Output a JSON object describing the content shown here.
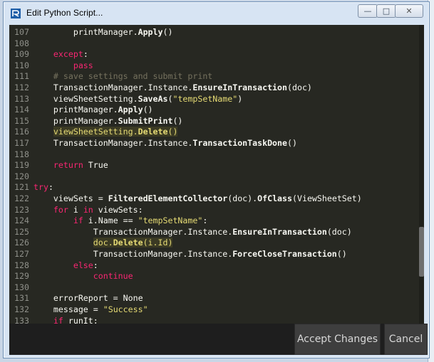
{
  "window": {
    "title": "Edit Python Script..."
  },
  "controls": {
    "minimize": "—",
    "maximize": "□",
    "close": "✕"
  },
  "code_lines": [
    {
      "n": "107",
      "segments": [
        {
          "t": "        "
        },
        {
          "t": "printManager.",
          "c": ""
        },
        {
          "t": "Apply",
          "c": "fn"
        },
        {
          "t": "()"
        }
      ]
    },
    {
      "n": "108",
      "segments": []
    },
    {
      "n": "109",
      "segments": [
        {
          "t": "    "
        },
        {
          "t": "except",
          "c": "kw"
        },
        {
          "t": ":"
        }
      ]
    },
    {
      "n": "110",
      "segments": [
        {
          "t": "        "
        },
        {
          "t": "pass",
          "c": "kw"
        }
      ]
    },
    {
      "n": "111",
      "segments": [
        {
          "t": "    "
        },
        {
          "t": "# save settings and submit print",
          "c": "cm"
        }
      ]
    },
    {
      "n": "112",
      "segments": [
        {
          "t": "    TransactionManager.Instance."
        },
        {
          "t": "EnsureInTransaction",
          "c": "fn"
        },
        {
          "t": "(doc)"
        }
      ]
    },
    {
      "n": "113",
      "segments": [
        {
          "t": "    viewSheetSetting."
        },
        {
          "t": "SaveAs",
          "c": "fn"
        },
        {
          "t": "("
        },
        {
          "t": "\"tempSetName\"",
          "c": "str"
        },
        {
          "t": ")"
        }
      ]
    },
    {
      "n": "114",
      "segments": [
        {
          "t": "    printManager."
        },
        {
          "t": "Apply",
          "c": "fn"
        },
        {
          "t": "()"
        }
      ]
    },
    {
      "n": "115",
      "segments": [
        {
          "t": "    printManager."
        },
        {
          "t": "SubmitPrint",
          "c": "fn"
        },
        {
          "t": "()"
        }
      ]
    },
    {
      "n": "116",
      "segments": [
        {
          "t": "    "
        },
        {
          "t": "viewSheetSetting.",
          "c": "hlw hl"
        },
        {
          "t": "Delete",
          "c": "fn hlw hl"
        },
        {
          "t": "()",
          "c": "hlw hl"
        }
      ]
    },
    {
      "n": "117",
      "segments": [
        {
          "t": "    TransactionManager.Instance."
        },
        {
          "t": "TransactionTaskDone",
          "c": "fn"
        },
        {
          "t": "()"
        }
      ]
    },
    {
      "n": "118",
      "segments": []
    },
    {
      "n": "119",
      "segments": [
        {
          "t": "    "
        },
        {
          "t": "return",
          "c": "kw"
        },
        {
          "t": " True"
        }
      ]
    },
    {
      "n": "120",
      "segments": []
    },
    {
      "n": "121",
      "segments": [
        {
          "t": "try",
          "c": "kw"
        },
        {
          "t": ":"
        }
      ]
    },
    {
      "n": "122",
      "segments": [
        {
          "t": "    viewSets = "
        },
        {
          "t": "FilteredElementCollector",
          "c": "fn"
        },
        {
          "t": "(doc)."
        },
        {
          "t": "OfClass",
          "c": "fn"
        },
        {
          "t": "(ViewSheetSet)"
        }
      ]
    },
    {
      "n": "123",
      "segments": [
        {
          "t": "    "
        },
        {
          "t": "for",
          "c": "kw"
        },
        {
          "t": " i "
        },
        {
          "t": "in",
          "c": "kw"
        },
        {
          "t": " viewSets:"
        }
      ]
    },
    {
      "n": "124",
      "segments": [
        {
          "t": "        "
        },
        {
          "t": "if",
          "c": "kw"
        },
        {
          "t": " i.Name == "
        },
        {
          "t": "\"tempSetName\"",
          "c": "str"
        },
        {
          "t": ":"
        }
      ]
    },
    {
      "n": "125",
      "segments": [
        {
          "t": "            TransactionManager.Instance."
        },
        {
          "t": "EnsureInTransaction",
          "c": "fn"
        },
        {
          "t": "(doc)"
        }
      ]
    },
    {
      "n": "126",
      "segments": [
        {
          "t": "            "
        },
        {
          "t": "doc.",
          "c": "hlw hl"
        },
        {
          "t": "Delete",
          "c": "fn hlw hl"
        },
        {
          "t": "(i.Id)",
          "c": "hlw hl"
        }
      ]
    },
    {
      "n": "127",
      "segments": [
        {
          "t": "            TransactionManager.Instance."
        },
        {
          "t": "ForceCloseTransaction",
          "c": "fn"
        },
        {
          "t": "()"
        }
      ]
    },
    {
      "n": "128",
      "segments": [
        {
          "t": "        "
        },
        {
          "t": "else",
          "c": "kw"
        },
        {
          "t": ":"
        }
      ]
    },
    {
      "n": "129",
      "segments": [
        {
          "t": "            "
        },
        {
          "t": "continue",
          "c": "kw"
        }
      ]
    },
    {
      "n": "130",
      "segments": []
    },
    {
      "n": "131",
      "segments": [
        {
          "t": "    errorReport = None"
        }
      ]
    },
    {
      "n": "132",
      "segments": [
        {
          "t": "    message = "
        },
        {
          "t": "\"Success\"",
          "c": "str"
        }
      ]
    },
    {
      "n": "133",
      "segments": [
        {
          "t": "    "
        },
        {
          "t": "if",
          "c": "kw"
        },
        {
          "t": " runIt:"
        }
      ]
    }
  ],
  "footer": {
    "accept_label": "Accept Changes",
    "cancel_label": "Cancel"
  },
  "colors": {
    "editor_bg": "#272822",
    "keyword": "#f92672",
    "string": "#e6db74",
    "comment": "#75715e",
    "highlight": "#3b3a24"
  }
}
